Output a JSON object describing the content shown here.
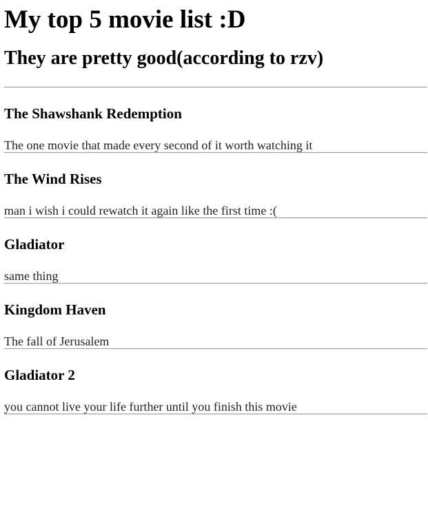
{
  "page": {
    "title": "My top 5 movie list :D",
    "subtitle": "They are pretty good(according to rzv)"
  },
  "movies": [
    {
      "title": "The Shawshank Redemption",
      "description": "The one movie that made every second of it worth watching it"
    },
    {
      "title": "The Wind Rises",
      "description": "man i wish i could rewatch it again like the first time :("
    },
    {
      "title": "Gladiator",
      "description": "same thing"
    },
    {
      "title": "Kingdom Haven",
      "description": "The fall of Jerusalem"
    },
    {
      "title": "Gladiator 2",
      "description": "you cannot live your life further until you finish this movie"
    }
  ]
}
